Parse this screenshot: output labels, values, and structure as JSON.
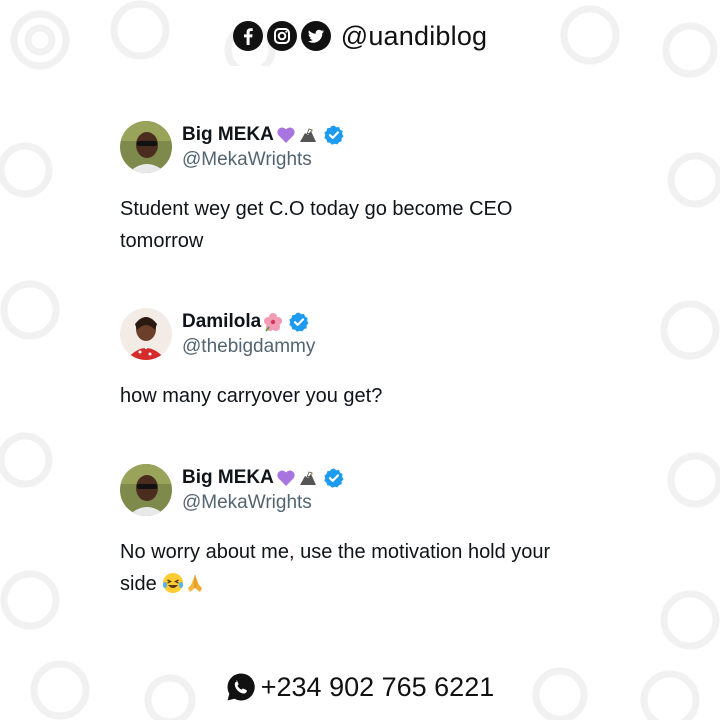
{
  "header": {
    "icons": [
      "facebook-icon",
      "instagram-icon",
      "twitter-icon"
    ],
    "handle": "@uandiblog"
  },
  "tweets": [
    {
      "display_name": "Big MEKA",
      "name_emojis": [
        "purple-heart-icon",
        "eagle-icon"
      ],
      "verified": true,
      "username": "@MekaWrights",
      "text": "Student wey get C.O today go become CEO tomorrow"
    },
    {
      "display_name": "Damilola",
      "name_emojis": [
        "hibiscus-icon"
      ],
      "verified": true,
      "username": "@thebigdammy",
      "text": "how many carryover you get?"
    },
    {
      "display_name": "Big MEKA",
      "name_emojis": [
        "purple-heart-icon",
        "eagle-icon"
      ],
      "verified": true,
      "username": "@MekaWrights",
      "text": "No worry about me, use the motivation hold your side",
      "text_emojis": [
        "laughing-tears-icon",
        "praying-hands-icon"
      ]
    }
  ],
  "footer": {
    "icon": "whatsapp-icon",
    "phone": "+234 902 765 6221"
  },
  "colors": {
    "verified_blue": "#1d9bf0",
    "name_text": "#0f1419",
    "username_text": "#536471",
    "purple_heart": "#a874e0"
  }
}
